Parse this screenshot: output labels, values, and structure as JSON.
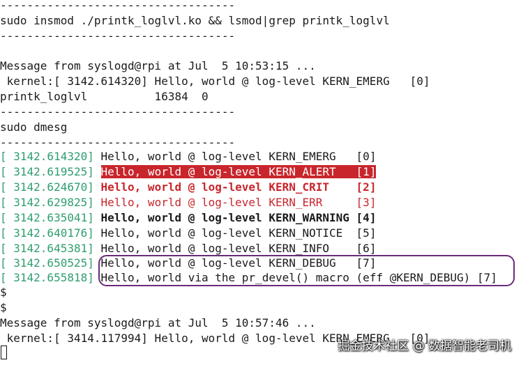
{
  "separator": "-----------------------------------",
  "insmod_cmd": "sudo insmod ./printk_loglvl.ko && lsmod|grep printk_loglvl",
  "syslog_msg_1": "Message from syslogd@rpi at Jul  5 10:53:15 ...",
  "kernel_line_1": " kernel:[ 3142.614320] Hello, world @ log-level KERN_EMERG   [0]",
  "lsmod_out": "printk_loglvl          16384  0",
  "dmesg_cmd": "sudo dmesg",
  "dmesg": [
    {
      "ts": "[ 3142.614320]",
      "msg": "Hello, world @ log-level KERN_EMERG   [0]",
      "style": "normal"
    },
    {
      "ts": "[ 3142.619525]",
      "msg": "Hello, world @ log-level KERN_ALERT   [1]",
      "style": "alert"
    },
    {
      "ts": "[ 3142.624670]",
      "msg": "Hello, world @ log-level KERN_CRIT    [2]",
      "style": "crit"
    },
    {
      "ts": "[ 3142.629825]",
      "msg": "Hello, world @ log-level KERN_ERR     [3]",
      "style": "err"
    },
    {
      "ts": "[ 3142.635041]",
      "msg": "Hello, world @ log-level KERN_WARNING [4]",
      "style": "warn"
    },
    {
      "ts": "[ 3142.640176]",
      "msg": "Hello, world @ log-level KERN_NOTICE  [5]",
      "style": "normal"
    },
    {
      "ts": "[ 3142.645381]",
      "msg": "Hello, world @ log-level KERN_INFO    [6]",
      "style": "normal"
    },
    {
      "ts": "[ 3142.650525]",
      "msg": "Hello, world @ log-level KERN_DEBUG   [7]",
      "style": "normal"
    },
    {
      "ts": "[ 3142.655818]",
      "msg": "Hello, world via the pr_devel() macro (eff @KERN_DEBUG) [7]",
      "style": "normal"
    }
  ],
  "prompt": "$",
  "syslog_msg_2": "Message from syslogd@rpi at Jul  5 10:57:46 ...",
  "kernel_line_2": " kernel:[ 3414.117994] Hello, world @ log-level KERN_EMERG   [0]",
  "watermark": "掘金技术社区 @ 数据智能老司机",
  "colors": {
    "timestamp": "#2e9e6e",
    "alert_bg": "#c8262c",
    "crit_err": "#c8262c",
    "highlight_oval": "#6a2a7a"
  }
}
